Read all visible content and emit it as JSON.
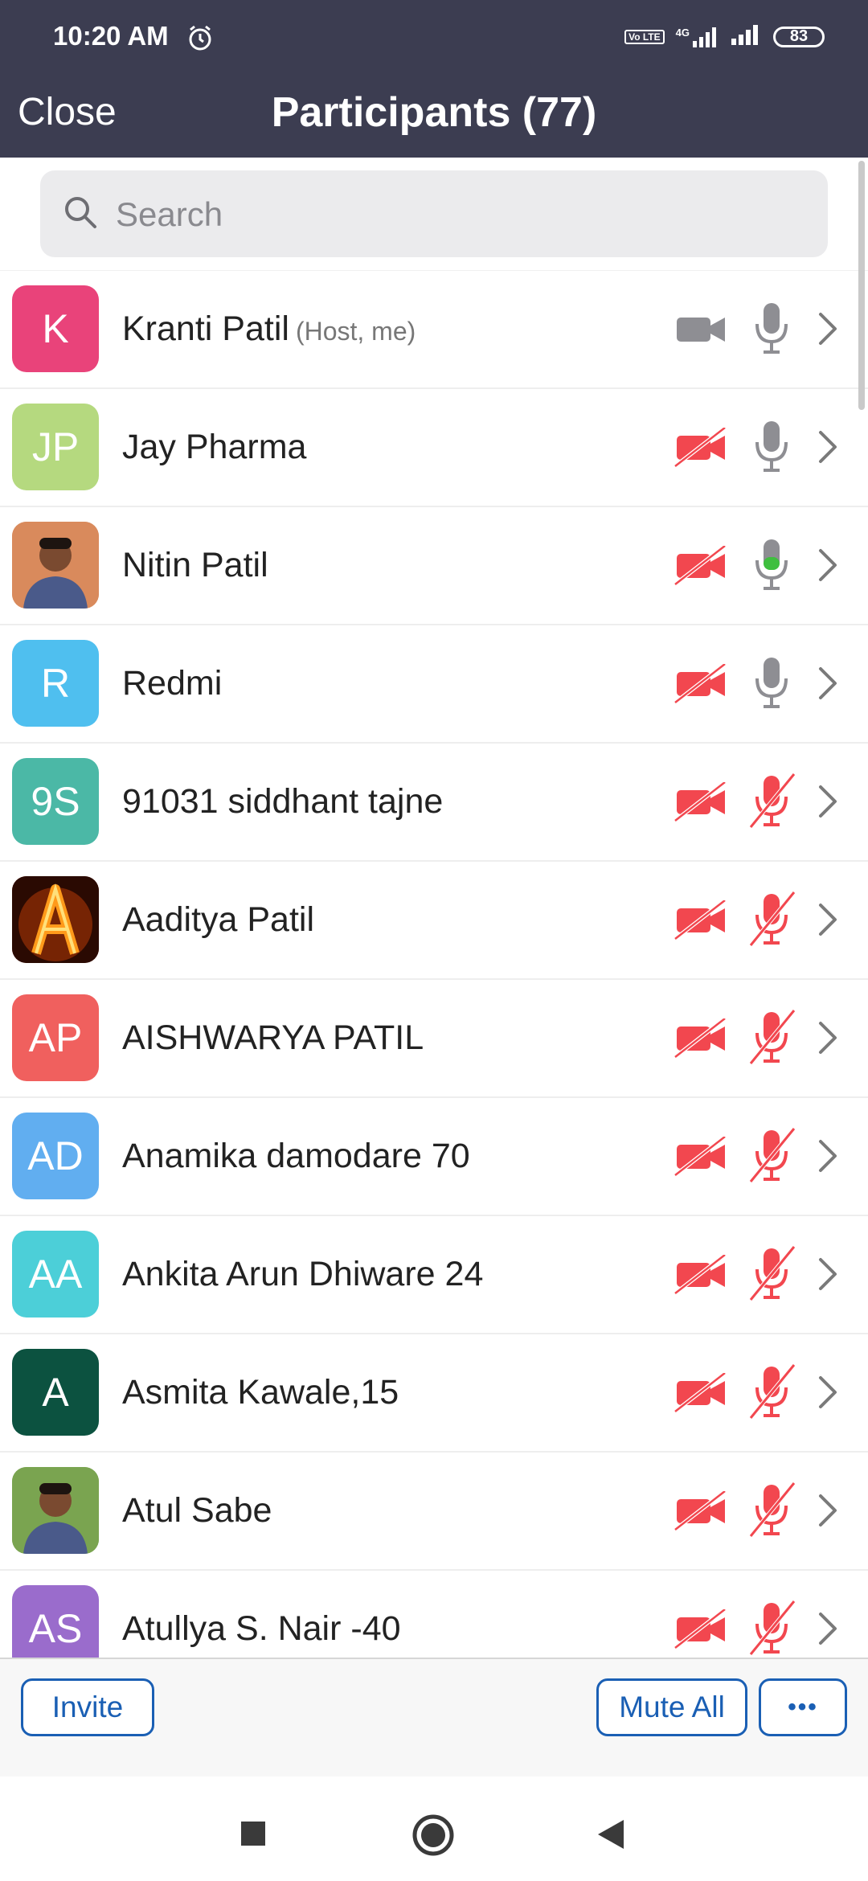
{
  "status": {
    "time": "10:20 AM",
    "network": "4G",
    "volte": "Vo LTE",
    "battery": "83"
  },
  "header": {
    "close_label": "Close",
    "title": "Participants (77)"
  },
  "search": {
    "placeholder": "Search"
  },
  "participants": [
    {
      "initials": "K",
      "name": "Kranti Patil",
      "role": "(Host, me)",
      "color": "#e9437a",
      "video": "off-neutral",
      "mic": "on"
    },
    {
      "initials": "JP",
      "name": "Jay Pharma",
      "role": "",
      "color": "#b5d97f",
      "video": "off",
      "mic": "on"
    },
    {
      "initials": "",
      "name": "Nitin Patil",
      "role": "",
      "color": "#d98a5c",
      "photo": "person-photo",
      "video": "off",
      "mic": "speaking"
    },
    {
      "initials": "R",
      "name": "Redmi",
      "role": "",
      "color": "#4fbfef",
      "video": "off",
      "mic": "on"
    },
    {
      "initials": "9S",
      "name": "91031 siddhant tajne",
      "role": "",
      "color": "#4bb8a6",
      "video": "off",
      "mic": "muted"
    },
    {
      "initials": "A",
      "name": "Aaditya Patil",
      "role": "",
      "color": "#7a1a06",
      "photo": "fire-letter-image",
      "video": "off",
      "mic": "muted"
    },
    {
      "initials": "AP",
      "name": "AISHWARYA PATIL",
      "role": "",
      "color": "#f0605e",
      "video": "off",
      "mic": "muted"
    },
    {
      "initials": "AD",
      "name": "Anamika damodare 70",
      "role": "",
      "color": "#61aef0",
      "video": "off",
      "mic": "muted"
    },
    {
      "initials": "AA",
      "name": "Ankita Arun Dhiware 24",
      "role": "",
      "color": "#4ccfd8",
      "video": "off",
      "mic": "muted"
    },
    {
      "initials": "A",
      "name": "Asmita Kawale,15",
      "role": "",
      "color": "#0c5240",
      "video": "off",
      "mic": "muted"
    },
    {
      "initials": "",
      "name": "Atul Sabe",
      "role": "",
      "color": "#7aa450",
      "photo": "person-photo",
      "video": "off",
      "mic": "muted"
    },
    {
      "initials": "AS",
      "name": "Atullya S. Nair -40",
      "role": "",
      "color": "#9a6ccc",
      "video": "off",
      "mic": "muted"
    }
  ],
  "footer": {
    "invite_label": "Invite",
    "mute_all_label": "Mute All",
    "more_label": "•••"
  },
  "colors": {
    "accent": "#1a5fb4",
    "header_bg": "#3c3d51",
    "muted_red": "#f2474f",
    "speaking_green": "#3fbf3f",
    "icon_gray": "#8e8e93"
  }
}
